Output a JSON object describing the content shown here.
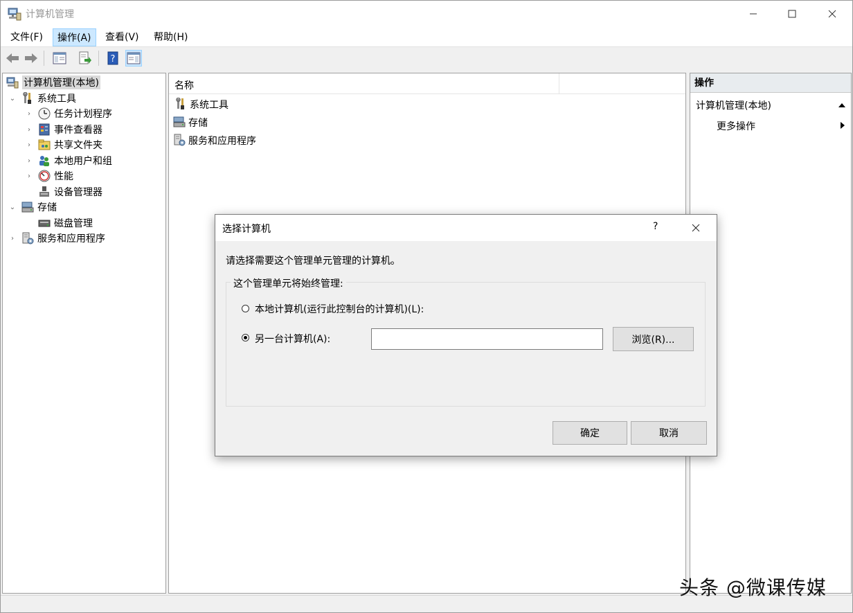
{
  "window": {
    "title": "计算机管理"
  },
  "menu": {
    "items": [
      "文件(F)",
      "操作(A)",
      "查看(V)",
      "帮助(H)"
    ],
    "active": "操作(A)"
  },
  "tree": {
    "root": "计算机管理(本地)",
    "system_tools": "系统工具",
    "task_scheduler": "任务计划程序",
    "event_viewer": "事件查看器",
    "shared_folders": "共享文件夹",
    "local_users": "本地用户和组",
    "performance": "性能",
    "device_manager": "设备管理器",
    "storage": "存储",
    "disk_management": "磁盘管理",
    "services_apps": "服务和应用程序"
  },
  "list": {
    "column_name": "名称",
    "items": [
      "系统工具",
      "存储",
      "服务和应用程序"
    ]
  },
  "actions": {
    "header": "操作",
    "section": "计算机管理(本地)",
    "more": "更多操作"
  },
  "dialog": {
    "title": "选择计算机",
    "help": "?",
    "instruction": "请选择需要这个管理单元管理的计算机。",
    "group_label": "这个管理单元将始终管理:",
    "option_local": "本地计算机(运行此控制台的计算机)(L):",
    "option_other": "另一台计算机(A):",
    "computer_value": "",
    "browse": "浏览(R)...",
    "ok": "确定",
    "cancel": "取消",
    "selected_option": "other"
  },
  "watermark": "头条 @微课传媒"
}
